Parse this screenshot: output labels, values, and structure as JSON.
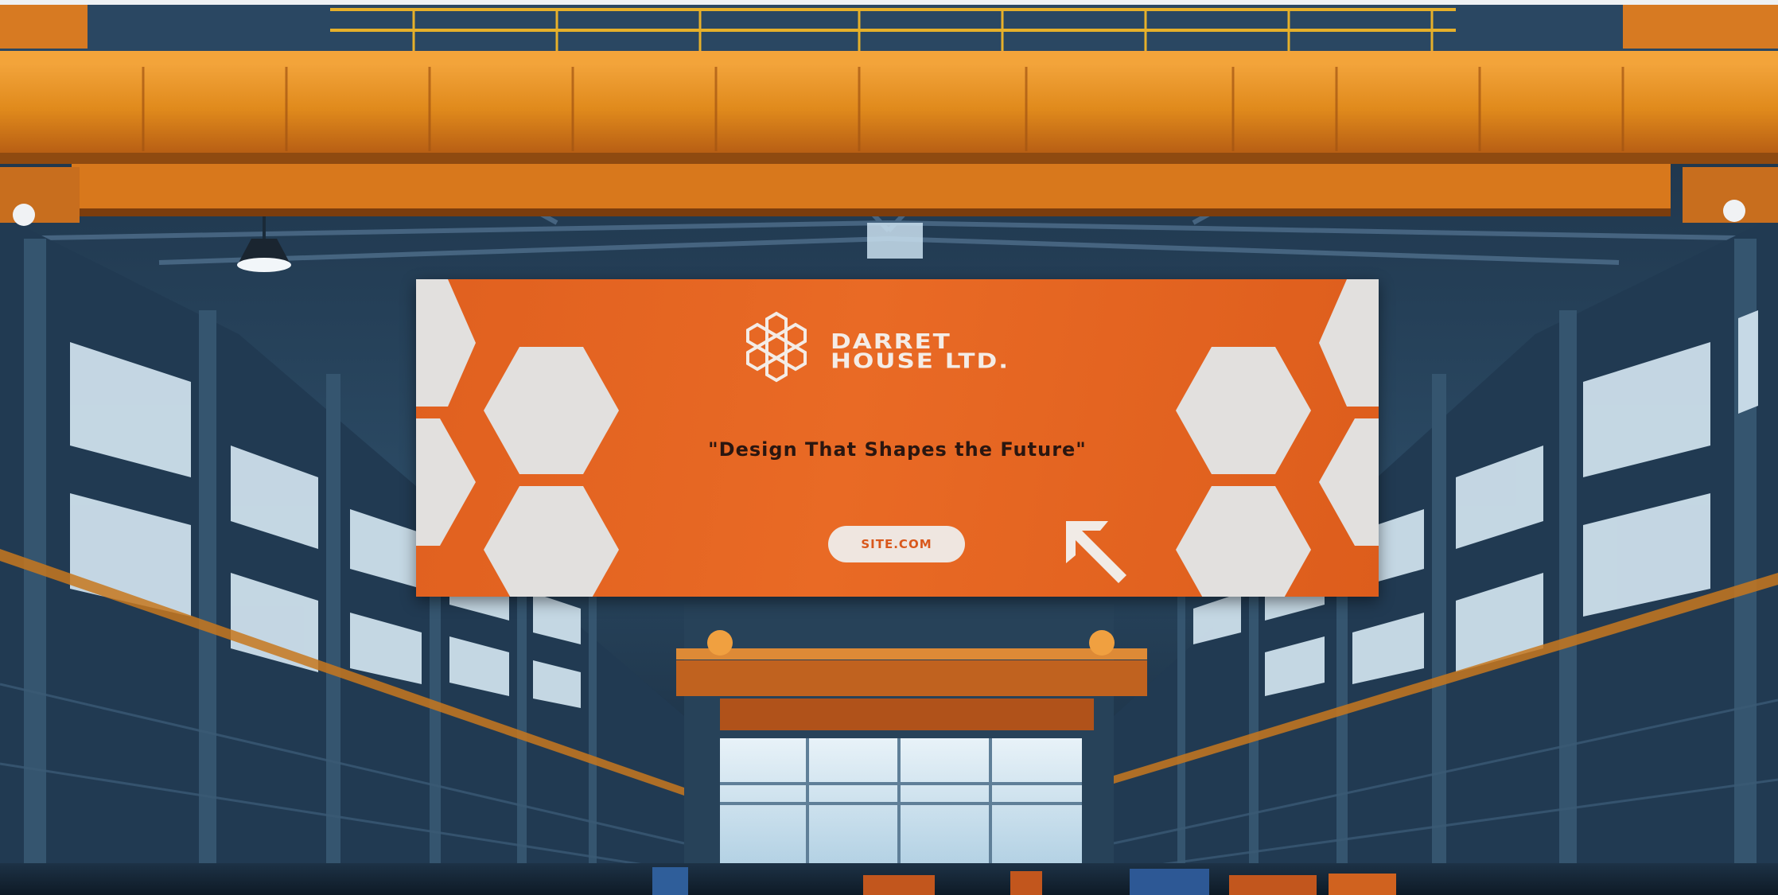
{
  "scene": {
    "description_icon": "industrial-warehouse-photo",
    "colors": {
      "crane_orange": "#e0861c",
      "steel_blue": "#2d4a63",
      "window_light": "#cfe3f0",
      "banner_orange": "#e3621f",
      "hexagon_fill": "#e2e0de",
      "text_light": "#f4ece6",
      "text_dark": "#2a1610"
    }
  },
  "banner": {
    "brand_line_1": "DARRET",
    "brand_line_2": "HOUSE LTD.",
    "tagline": "\"Design That Shapes the Future\"",
    "site_label": "SITE.COM",
    "logo_icon": "hexagon-cluster-icon",
    "arrow_icon": "arrow-up-left-icon"
  }
}
